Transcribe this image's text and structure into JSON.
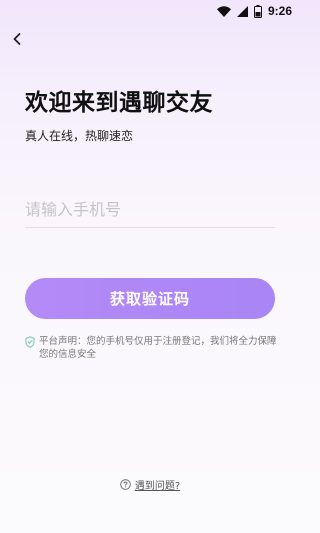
{
  "status_bar": {
    "time": "9:26",
    "icons": [
      "wifi-icon",
      "signal-icon",
      "battery-icon"
    ],
    "battery_level": 0.5
  },
  "header": {
    "back_icon": "chevron-left-icon"
  },
  "main": {
    "title": "欢迎来到遇聊交友",
    "subtitle": "真人在线，热聊速恋",
    "phone_input": {
      "value": "",
      "placeholder": "请输入手机号"
    },
    "code_button_label": "获取验证码",
    "notice": {
      "icon": "shield-check-icon",
      "text": "平台声明：您的手机号仅用于注册登记，我们将全力保障您的信息安全"
    }
  },
  "footer": {
    "help_icon": "question-circle-icon",
    "help_label": "遇到问题?"
  },
  "colors": {
    "accent": "#ac87f6",
    "background_top": "#f1e6fb",
    "background_bottom": "#fbfafc"
  }
}
